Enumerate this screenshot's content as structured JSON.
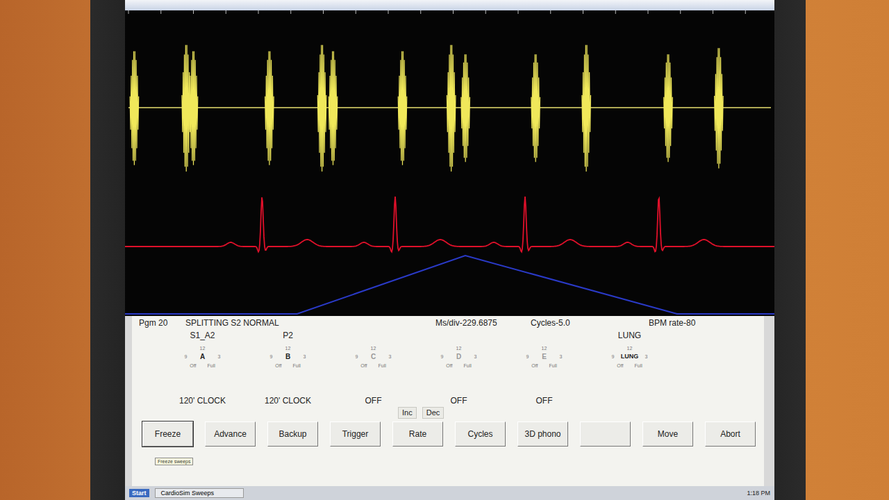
{
  "program": {
    "number": "Pgm 20",
    "name": "SPLITTING S2 NORMAL",
    "ms_div": "Ms/div-229.6875",
    "cycles": "Cycles-5.0",
    "bpm": "BPM rate-80"
  },
  "knob_scale": {
    "top": "12",
    "left": "9",
    "right": "3",
    "off": "Off",
    "full": "Full"
  },
  "channels": [
    {
      "label": "S1_A2",
      "knob": "A",
      "setting": "120' CLOCK",
      "on": true
    },
    {
      "label": "P2",
      "knob": "B",
      "setting": "120' CLOCK",
      "on": true
    },
    {
      "label": "",
      "knob": "C",
      "setting": "OFF",
      "on": false
    },
    {
      "label": "",
      "knob": "D",
      "setting": "OFF",
      "on": false
    },
    {
      "label": "",
      "knob": "E",
      "setting": "OFF",
      "on": false
    },
    {
      "label": "LUNG",
      "knob": "LUNG",
      "setting": "",
      "on": true
    }
  ],
  "rate_buttons": [
    "Inc",
    "Dec"
  ],
  "buttons": [
    {
      "label": "Freeze",
      "selected": true
    },
    {
      "label": "Advance",
      "selected": false
    },
    {
      "label": "Backup",
      "selected": false
    },
    {
      "label": "Trigger",
      "selected": false
    },
    {
      "label": "Rate",
      "selected": false
    },
    {
      "label": "Cycles",
      "selected": false
    },
    {
      "label": "3D phono",
      "selected": false
    },
    {
      "label": "",
      "selected": false
    },
    {
      "label": "Move",
      "selected": false
    },
    {
      "label": "Abort",
      "selected": false
    }
  ],
  "tooltip": "Freeze sweeps",
  "taskbar": {
    "start": "Start",
    "task": "CardioSim Sweeps",
    "clock": "1:18 PM"
  },
  "scope": {
    "phono": [
      {
        "t": 0.014,
        "amp": 0.9
      },
      {
        "t": 0.094,
        "amp": 1.0
      },
      {
        "t": 0.105,
        "amp": 0.9
      },
      {
        "t": 0.222,
        "amp": 0.9
      },
      {
        "t": 0.303,
        "amp": 1.0
      },
      {
        "t": 0.32,
        "amp": 0.9
      },
      {
        "t": 0.427,
        "amp": 0.9
      },
      {
        "t": 0.502,
        "amp": 1.0
      },
      {
        "t": 0.524,
        "amp": 0.85
      },
      {
        "t": 0.632,
        "amp": 0.85
      },
      {
        "t": 0.71,
        "amp": 1.0
      },
      {
        "t": 0.836,
        "amp": 0.85
      },
      {
        "t": 0.914,
        "amp": 0.95
      }
    ],
    "ecg_r_peaks": [
      0.211,
      0.416,
      0.616,
      0.822
    ],
    "respiration": [
      [
        0,
        0
      ],
      [
        0.265,
        0
      ],
      [
        0.524,
        1
      ],
      [
        0.85,
        0
      ],
      [
        1,
        0
      ]
    ]
  }
}
